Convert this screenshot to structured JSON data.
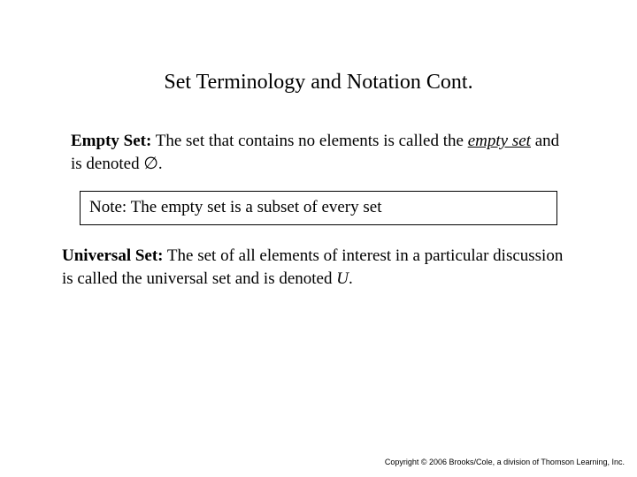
{
  "title": "Set Terminology and Notation Cont.",
  "empty_set": {
    "label": "Empty Set:",
    "text1": "  The set that contains no elements is called the ",
    "term_italic": "empty set",
    "text2": " and is denoted  ",
    "symbol": "∅",
    "text3": "."
  },
  "note": {
    "prefix": "Note:  ",
    "text": "The empty set is a subset of every set"
  },
  "universal_set": {
    "label": "Universal Set:",
    "text1": "  The set of all elements of interest in a particular discussion is called the universal set and is denoted ",
    "symbol": "U",
    "text2": "."
  },
  "copyright": "Copyright © 2006 Brooks/Cole, a division of Thomson Learning, Inc."
}
